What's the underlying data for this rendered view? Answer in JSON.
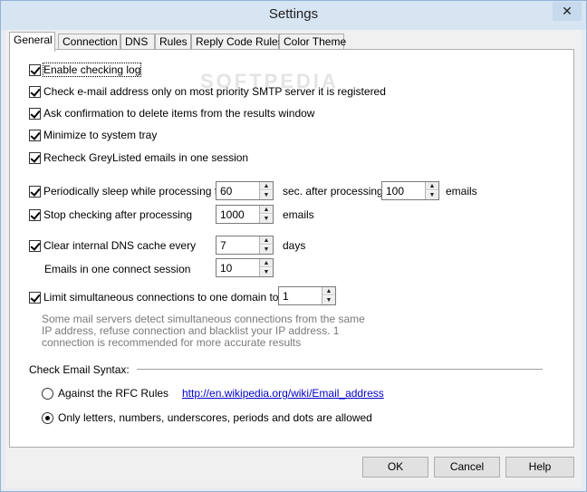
{
  "window": {
    "title": "Settings",
    "close_glyph": "✕"
  },
  "tabs": [
    {
      "label": "General",
      "active": true
    },
    {
      "label": "Connection",
      "active": false
    },
    {
      "label": "DNS",
      "active": false
    },
    {
      "label": "Rules",
      "active": false
    },
    {
      "label": "Reply Code Rules",
      "active": false
    },
    {
      "label": "Color Theme",
      "active": false
    }
  ],
  "general": {
    "enable_checking_log": {
      "label": "Enable checking log",
      "checked": true
    },
    "check_most_priority": {
      "label": "Check e-mail address only on most priority SMTP server it is registered",
      "checked": true
    },
    "ask_confirmation": {
      "label": "Ask confirmation to delete items from the results window",
      "checked": true
    },
    "minimize_tray": {
      "label": "Minimize to system tray",
      "checked": true
    },
    "recheck_greylisted": {
      "label": "Recheck GreyListed emails in one session",
      "checked": true
    },
    "periodic_sleep": {
      "label": "Periodically sleep while processing for",
      "checked": true,
      "sleep_value": "60",
      "after_label": "sec. after processing",
      "emails_value": "100",
      "emails_label": "emails"
    },
    "stop_checking": {
      "label": "Stop checking after processing",
      "checked": true,
      "value": "1000",
      "unit": "emails"
    },
    "clear_dns": {
      "label": "Clear internal DNS cache every",
      "checked": true,
      "value": "7",
      "unit": "days"
    },
    "emails_per_session": {
      "label": "Emails in one connect session",
      "value": "10"
    },
    "limit_connections": {
      "label": "Limit simultaneous connections to one domain to",
      "checked": true,
      "value": "1",
      "note": "Some mail servers detect simultaneous connections from the same IP address, refuse connection and blacklist your IP address. 1 connection is recommended for more accurate results"
    },
    "syntax": {
      "heading": "Check Email Syntax:",
      "rfc": {
        "label": "Against the RFC Rules",
        "selected": false,
        "link": "http://en.wikipedia.org/wiki/Email_address"
      },
      "simple": {
        "label": "Only letters, numbers, underscores, periods and dots are allowed",
        "selected": true
      }
    }
  },
  "buttons": {
    "ok": "OK",
    "cancel": "Cancel",
    "help": "Help"
  },
  "watermark": "SOFTPEDIA",
  "colors": {
    "titlebar": "#d7e4f2",
    "link": "#0000cc",
    "note": "#7a7a7a"
  }
}
